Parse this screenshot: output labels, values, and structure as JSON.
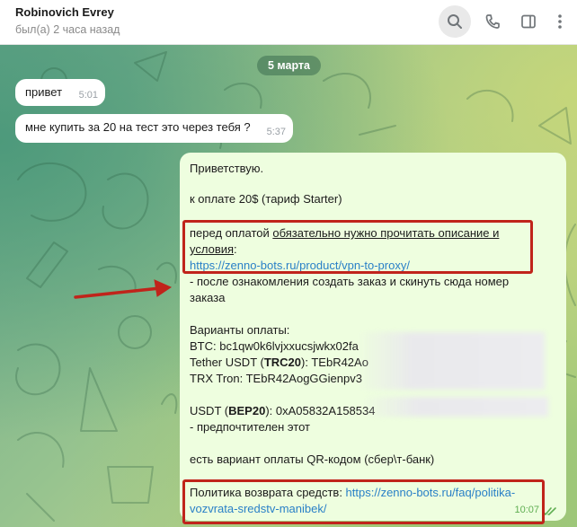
{
  "header": {
    "contact_name": "Robinovich Evrey",
    "status": "был(а) 2 часа назад",
    "icons": [
      "search-icon",
      "phone-icon",
      "sidebar-icon",
      "more-icon"
    ]
  },
  "chat": {
    "date_label": "5 марта",
    "incoming": [
      {
        "text": "привет",
        "time": "5:01"
      },
      {
        "text": "мне купить за 20 на тест это через тебя ?",
        "time": "5:37"
      }
    ],
    "outgoing": {
      "greeting": "Приветствую.",
      "payment_line": "к оплате 20$ (тариф Starter)",
      "before_pay_prefix": "перед оплатой ",
      "before_pay_underlined_1": "обязательно нужно прочитать описание и",
      "before_pay_underlined_2": "условия",
      "before_pay_colon": ":",
      "link_product": "https://zenno-bots.ru/product/vpn-to-proxy/",
      "after_read_1": "- после ознакомления создать заказ и скинуть сюда номер",
      "after_read_2": "заказа",
      "variants_title": "Варианты оплаты:",
      "btc": "BTC: bc1qw0k6lvjxxucsjwkx02fa",
      "tether_prefix": "Tether USDT (",
      "tether_bold": "TRC20",
      "tether_suffix": "): TEbR42Ao",
      "trx": "TRX Tron: TEbR42AogGGienpv3",
      "usdt_prefix": "USDT  (",
      "usdt_bold": "BEP20",
      "usdt_suffix": "): 0xA05832A158534",
      "preferred": "- предпочтителен этот",
      "qr": "есть вариант оплаты QR-кодом (сбер\\т-банк)",
      "refund_label": "Политика возврата средств: ",
      "refund_link_1": "https://zenno-bots.ru/faq/politika-",
      "refund_link_2": "vozvrata-sredstv-manibek/",
      "time": "10:07"
    }
  },
  "colors": {
    "accent": "#c0241b",
    "link": "#2a80c7",
    "outgoing_bubble": "#eefedf",
    "read_ticks": "#5fae52"
  }
}
